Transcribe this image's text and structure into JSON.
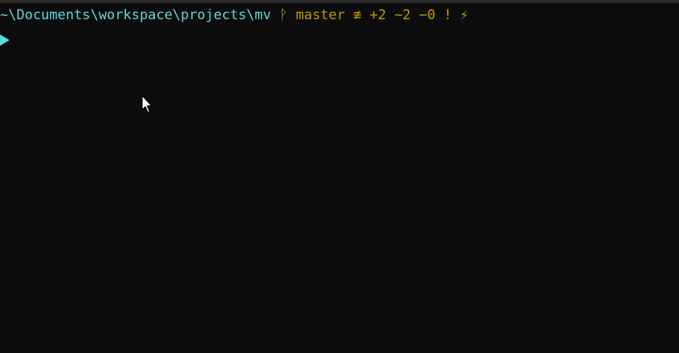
{
  "terminal": {
    "prompt": {
      "path": "~\\Documents\\workspace\\projects\\mv",
      "branch_glyph": "ᚹ",
      "branch": "master",
      "status": "≢ +2 ~2 −0 !",
      "bolt": "⚡"
    },
    "input": {
      "value": ""
    }
  },
  "colors": {
    "background": "#0c0c0c",
    "path": "#61d6d6",
    "git": "#c19c00",
    "prompt_arrow": "#61d6d6"
  },
  "icons": {
    "branch": "git-branch-icon",
    "bolt": "lightning-icon",
    "prompt": "prompt-arrow-icon",
    "pointer": "mouse-pointer-icon"
  }
}
